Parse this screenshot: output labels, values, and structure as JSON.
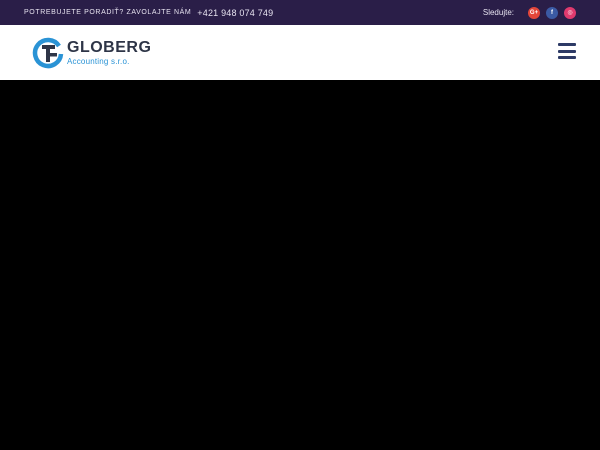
{
  "topbar": {
    "cta_text": "POTREBUJETE PORADIŤ? ZAVOLAJTE NÁM",
    "phone": "+421 948 074 749",
    "follow_label": "Sledujte:",
    "socials": [
      {
        "icon": "google-plus-icon",
        "glyph": "G+",
        "color": "#e3463a"
      },
      {
        "icon": "facebook-icon",
        "glyph": "f",
        "color": "#3b5aa4"
      },
      {
        "icon": "instagram-icon",
        "glyph": "◎",
        "color": "#e03a6e"
      }
    ]
  },
  "header": {
    "logo_name": "GLOBERG",
    "logo_sub": "Accounting s.r.o.",
    "logo_colors": {
      "dark": "#2e3547",
      "blue": "#2a93d5"
    },
    "menu_icon": "hamburger-menu-icon"
  },
  "colors": {
    "topbar_bg": "#2a1e48",
    "header_bg": "#ffffff",
    "hero_bg": "#000000"
  }
}
